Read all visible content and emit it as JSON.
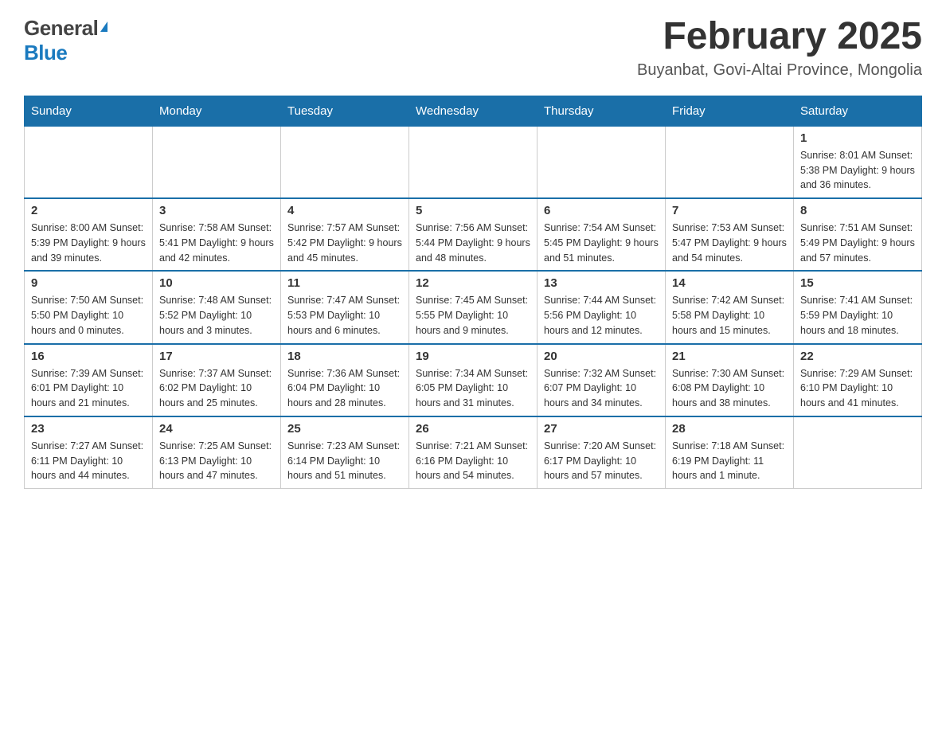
{
  "header": {
    "logo_general": "General",
    "logo_blue": "Blue",
    "month_title": "February 2025",
    "location": "Buyanbat, Govi-Altai Province, Mongolia"
  },
  "weekdays": [
    "Sunday",
    "Monday",
    "Tuesday",
    "Wednesday",
    "Thursday",
    "Friday",
    "Saturday"
  ],
  "weeks": [
    [
      {
        "day": "",
        "info": ""
      },
      {
        "day": "",
        "info": ""
      },
      {
        "day": "",
        "info": ""
      },
      {
        "day": "",
        "info": ""
      },
      {
        "day": "",
        "info": ""
      },
      {
        "day": "",
        "info": ""
      },
      {
        "day": "1",
        "info": "Sunrise: 8:01 AM\nSunset: 5:38 PM\nDaylight: 9 hours and 36 minutes."
      }
    ],
    [
      {
        "day": "2",
        "info": "Sunrise: 8:00 AM\nSunset: 5:39 PM\nDaylight: 9 hours and 39 minutes."
      },
      {
        "day": "3",
        "info": "Sunrise: 7:58 AM\nSunset: 5:41 PM\nDaylight: 9 hours and 42 minutes."
      },
      {
        "day": "4",
        "info": "Sunrise: 7:57 AM\nSunset: 5:42 PM\nDaylight: 9 hours and 45 minutes."
      },
      {
        "day": "5",
        "info": "Sunrise: 7:56 AM\nSunset: 5:44 PM\nDaylight: 9 hours and 48 minutes."
      },
      {
        "day": "6",
        "info": "Sunrise: 7:54 AM\nSunset: 5:45 PM\nDaylight: 9 hours and 51 minutes."
      },
      {
        "day": "7",
        "info": "Sunrise: 7:53 AM\nSunset: 5:47 PM\nDaylight: 9 hours and 54 minutes."
      },
      {
        "day": "8",
        "info": "Sunrise: 7:51 AM\nSunset: 5:49 PM\nDaylight: 9 hours and 57 minutes."
      }
    ],
    [
      {
        "day": "9",
        "info": "Sunrise: 7:50 AM\nSunset: 5:50 PM\nDaylight: 10 hours and 0 minutes."
      },
      {
        "day": "10",
        "info": "Sunrise: 7:48 AM\nSunset: 5:52 PM\nDaylight: 10 hours and 3 minutes."
      },
      {
        "day": "11",
        "info": "Sunrise: 7:47 AM\nSunset: 5:53 PM\nDaylight: 10 hours and 6 minutes."
      },
      {
        "day": "12",
        "info": "Sunrise: 7:45 AM\nSunset: 5:55 PM\nDaylight: 10 hours and 9 minutes."
      },
      {
        "day": "13",
        "info": "Sunrise: 7:44 AM\nSunset: 5:56 PM\nDaylight: 10 hours and 12 minutes."
      },
      {
        "day": "14",
        "info": "Sunrise: 7:42 AM\nSunset: 5:58 PM\nDaylight: 10 hours and 15 minutes."
      },
      {
        "day": "15",
        "info": "Sunrise: 7:41 AM\nSunset: 5:59 PM\nDaylight: 10 hours and 18 minutes."
      }
    ],
    [
      {
        "day": "16",
        "info": "Sunrise: 7:39 AM\nSunset: 6:01 PM\nDaylight: 10 hours and 21 minutes."
      },
      {
        "day": "17",
        "info": "Sunrise: 7:37 AM\nSunset: 6:02 PM\nDaylight: 10 hours and 25 minutes."
      },
      {
        "day": "18",
        "info": "Sunrise: 7:36 AM\nSunset: 6:04 PM\nDaylight: 10 hours and 28 minutes."
      },
      {
        "day": "19",
        "info": "Sunrise: 7:34 AM\nSunset: 6:05 PM\nDaylight: 10 hours and 31 minutes."
      },
      {
        "day": "20",
        "info": "Sunrise: 7:32 AM\nSunset: 6:07 PM\nDaylight: 10 hours and 34 minutes."
      },
      {
        "day": "21",
        "info": "Sunrise: 7:30 AM\nSunset: 6:08 PM\nDaylight: 10 hours and 38 minutes."
      },
      {
        "day": "22",
        "info": "Sunrise: 7:29 AM\nSunset: 6:10 PM\nDaylight: 10 hours and 41 minutes."
      }
    ],
    [
      {
        "day": "23",
        "info": "Sunrise: 7:27 AM\nSunset: 6:11 PM\nDaylight: 10 hours and 44 minutes."
      },
      {
        "day": "24",
        "info": "Sunrise: 7:25 AM\nSunset: 6:13 PM\nDaylight: 10 hours and 47 minutes."
      },
      {
        "day": "25",
        "info": "Sunrise: 7:23 AM\nSunset: 6:14 PM\nDaylight: 10 hours and 51 minutes."
      },
      {
        "day": "26",
        "info": "Sunrise: 7:21 AM\nSunset: 6:16 PM\nDaylight: 10 hours and 54 minutes."
      },
      {
        "day": "27",
        "info": "Sunrise: 7:20 AM\nSunset: 6:17 PM\nDaylight: 10 hours and 57 minutes."
      },
      {
        "day": "28",
        "info": "Sunrise: 7:18 AM\nSunset: 6:19 PM\nDaylight: 11 hours and 1 minute."
      },
      {
        "day": "",
        "info": ""
      }
    ]
  ]
}
